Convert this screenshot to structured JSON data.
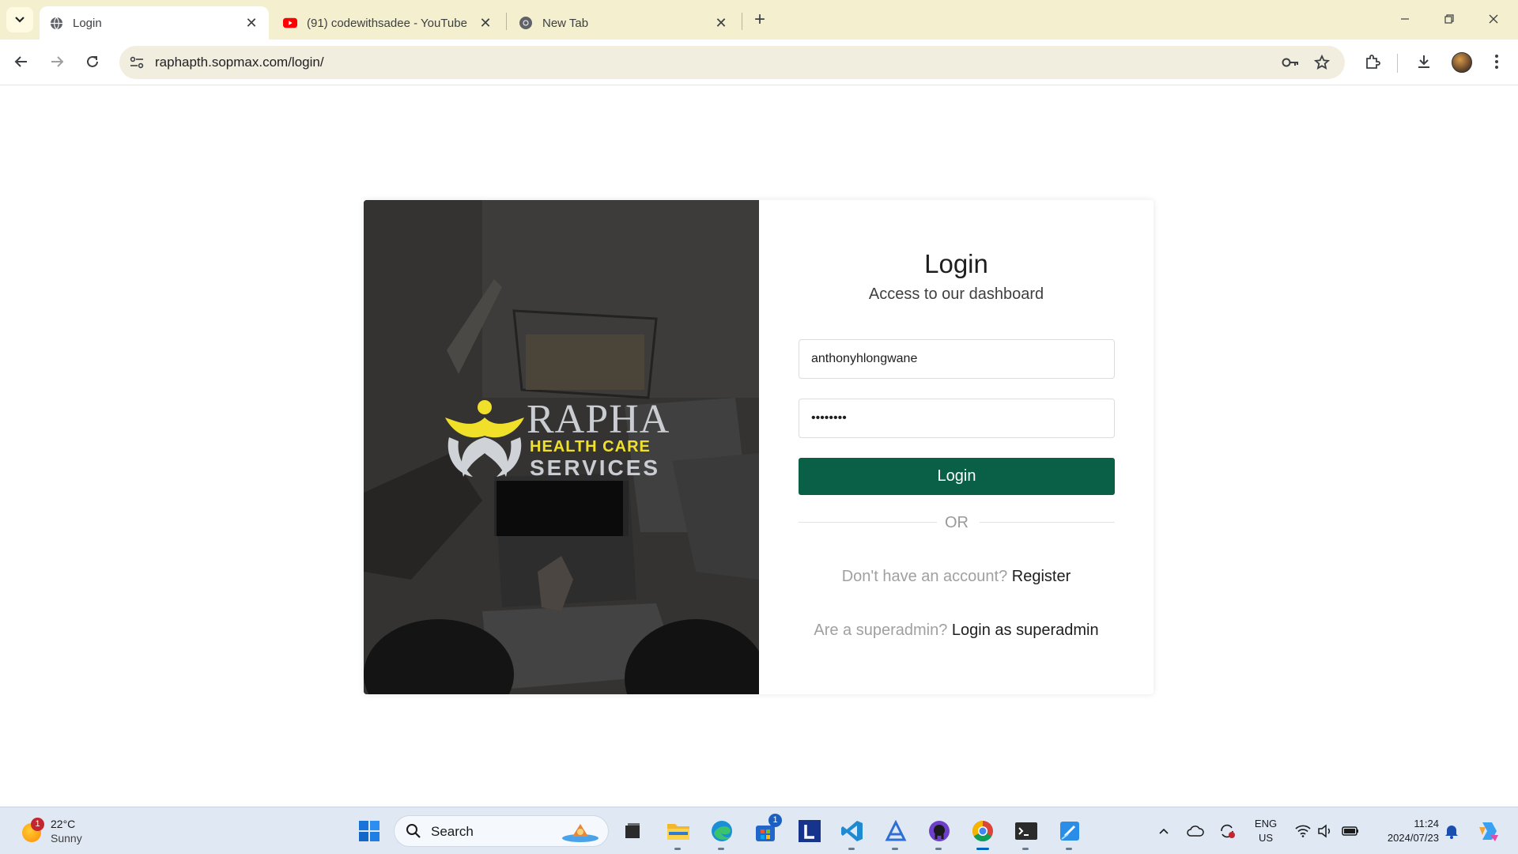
{
  "browser": {
    "tabs": [
      {
        "title": "Login",
        "icon": "globe-icon",
        "active": true
      },
      {
        "title": "(91) codewithsadee - YouTube",
        "icon": "youtube-icon",
        "active": false
      },
      {
        "title": "New Tab",
        "icon": "chrome-icon",
        "active": false
      }
    ],
    "close_glyph": "✕",
    "new_tab_glyph": "+",
    "url": "raphapth.sopmax.com/login/"
  },
  "login": {
    "title": "Login",
    "subtitle": "Access to our dashboard",
    "username_value": "anthonyhlongwane",
    "password_value": "password",
    "button_label": "Login",
    "divider_text": "OR",
    "register_prompt": "Don't have an account?",
    "register_link": "Register",
    "superadmin_prompt": "Are a superadmin?",
    "superadmin_link": "Login as superadmin"
  },
  "logo": {
    "line1": "RAPHA",
    "line2": "HEALTH CARE",
    "line3": "SERVICES"
  },
  "colors": {
    "primary_button": "#0a6046",
    "tabstrip": "#f3efcf",
    "logo_yellow": "#f1e02a",
    "taskbar": "#dfe8f3"
  },
  "taskbar": {
    "weather_temp": "22°C",
    "weather_condition": "Sunny",
    "weather_badge": "1",
    "search_label": "Search",
    "store_badge": "1",
    "lang_line1": "ENG",
    "lang_line2": "US",
    "time": "11:24",
    "date": "2024/07/23",
    "pinned": [
      "file-explorer-icon",
      "edge-icon",
      "microsoft-store-icon",
      "l-app-icon",
      "vscode-icon",
      "azure-data-studio-icon",
      "github-desktop-icon",
      "chrome-icon",
      "terminal-icon",
      "paint-icon"
    ]
  }
}
